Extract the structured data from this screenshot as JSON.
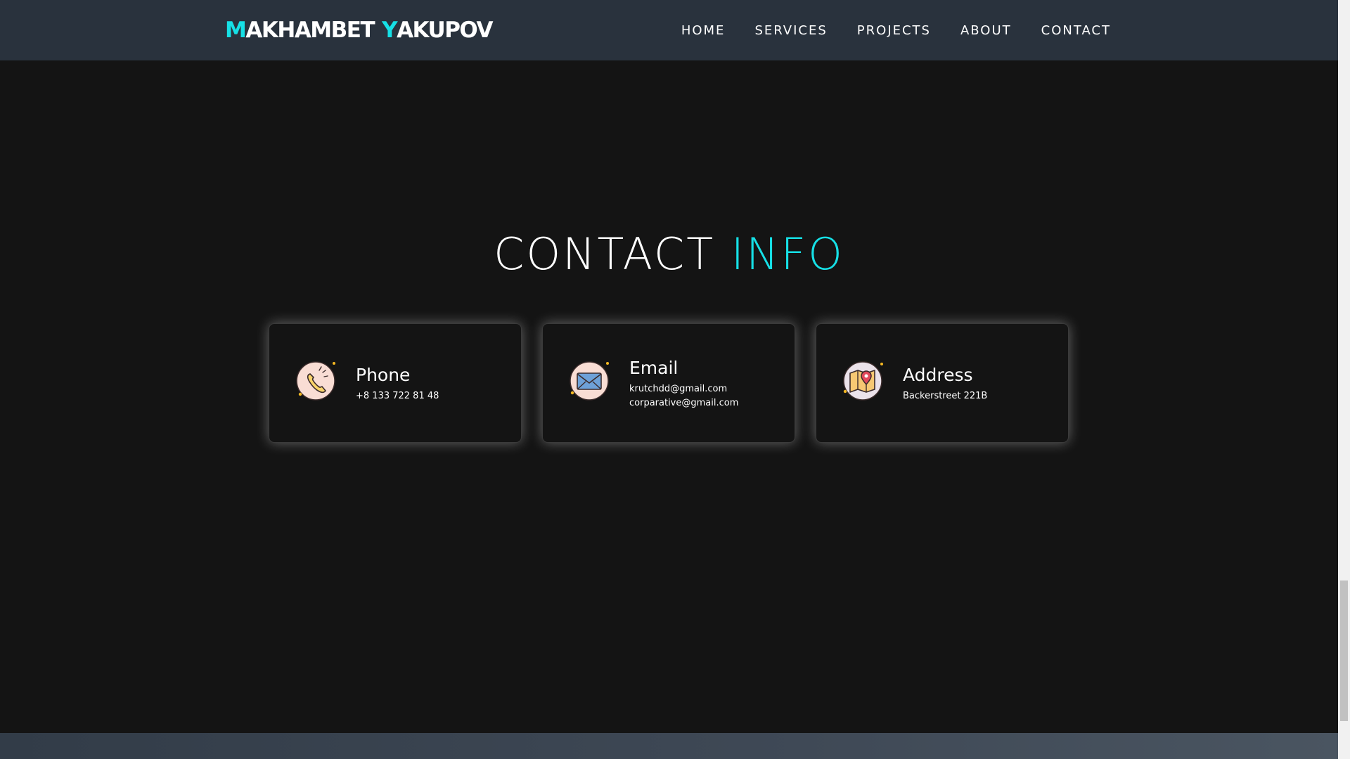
{
  "brand": {
    "first_initial": "M",
    "first_rest": "AKHAMBET",
    "last_initial": "Y",
    "last_rest": "AKUPOV"
  },
  "nav": {
    "items": [
      "HOME",
      "SERVICES",
      "PROJECTS",
      "ABOUT",
      "CONTACT"
    ]
  },
  "section": {
    "title_main": "CONTACT",
    "title_accent": "INFO"
  },
  "cards": [
    {
      "icon": "phone-icon",
      "label": "Phone",
      "lines": [
        "+8 133 722 81 48"
      ]
    },
    {
      "icon": "envelope-icon",
      "label": "Email",
      "lines": [
        "krutchdd@gmail.com",
        "corparative@gmail.com"
      ]
    },
    {
      "icon": "map-pin-icon",
      "label": "Address",
      "lines": [
        "Backerstreet 221B"
      ]
    }
  ],
  "colors": {
    "accent": "#16e0e6",
    "background": "#141414",
    "header": "#29323d"
  }
}
